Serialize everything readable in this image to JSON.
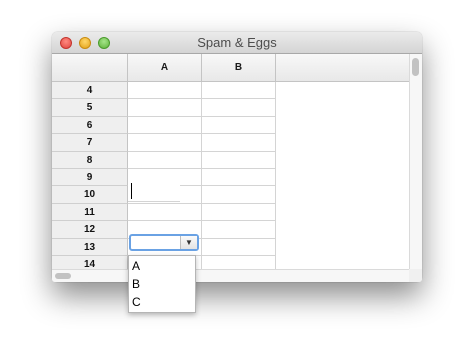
{
  "window": {
    "title": "Spam & Eggs"
  },
  "columns": [
    "A",
    "B"
  ],
  "rows": [
    "4",
    "5",
    "6",
    "7",
    "8",
    "9",
    "10",
    "11",
    "12",
    "13",
    "14"
  ],
  "combo": {
    "value": "",
    "arrow": "▼"
  },
  "popup": {
    "options": [
      "A",
      "B",
      "C"
    ]
  },
  "icons": {
    "close": "close-icon",
    "minimize": "minimize-icon",
    "zoom": "zoom-icon",
    "dropdown": "chevron-down-icon"
  },
  "colors": {
    "focus": "#6aa2e4",
    "close": "#e0443e",
    "minimize": "#e1a116",
    "zoom": "#5fb33a"
  }
}
